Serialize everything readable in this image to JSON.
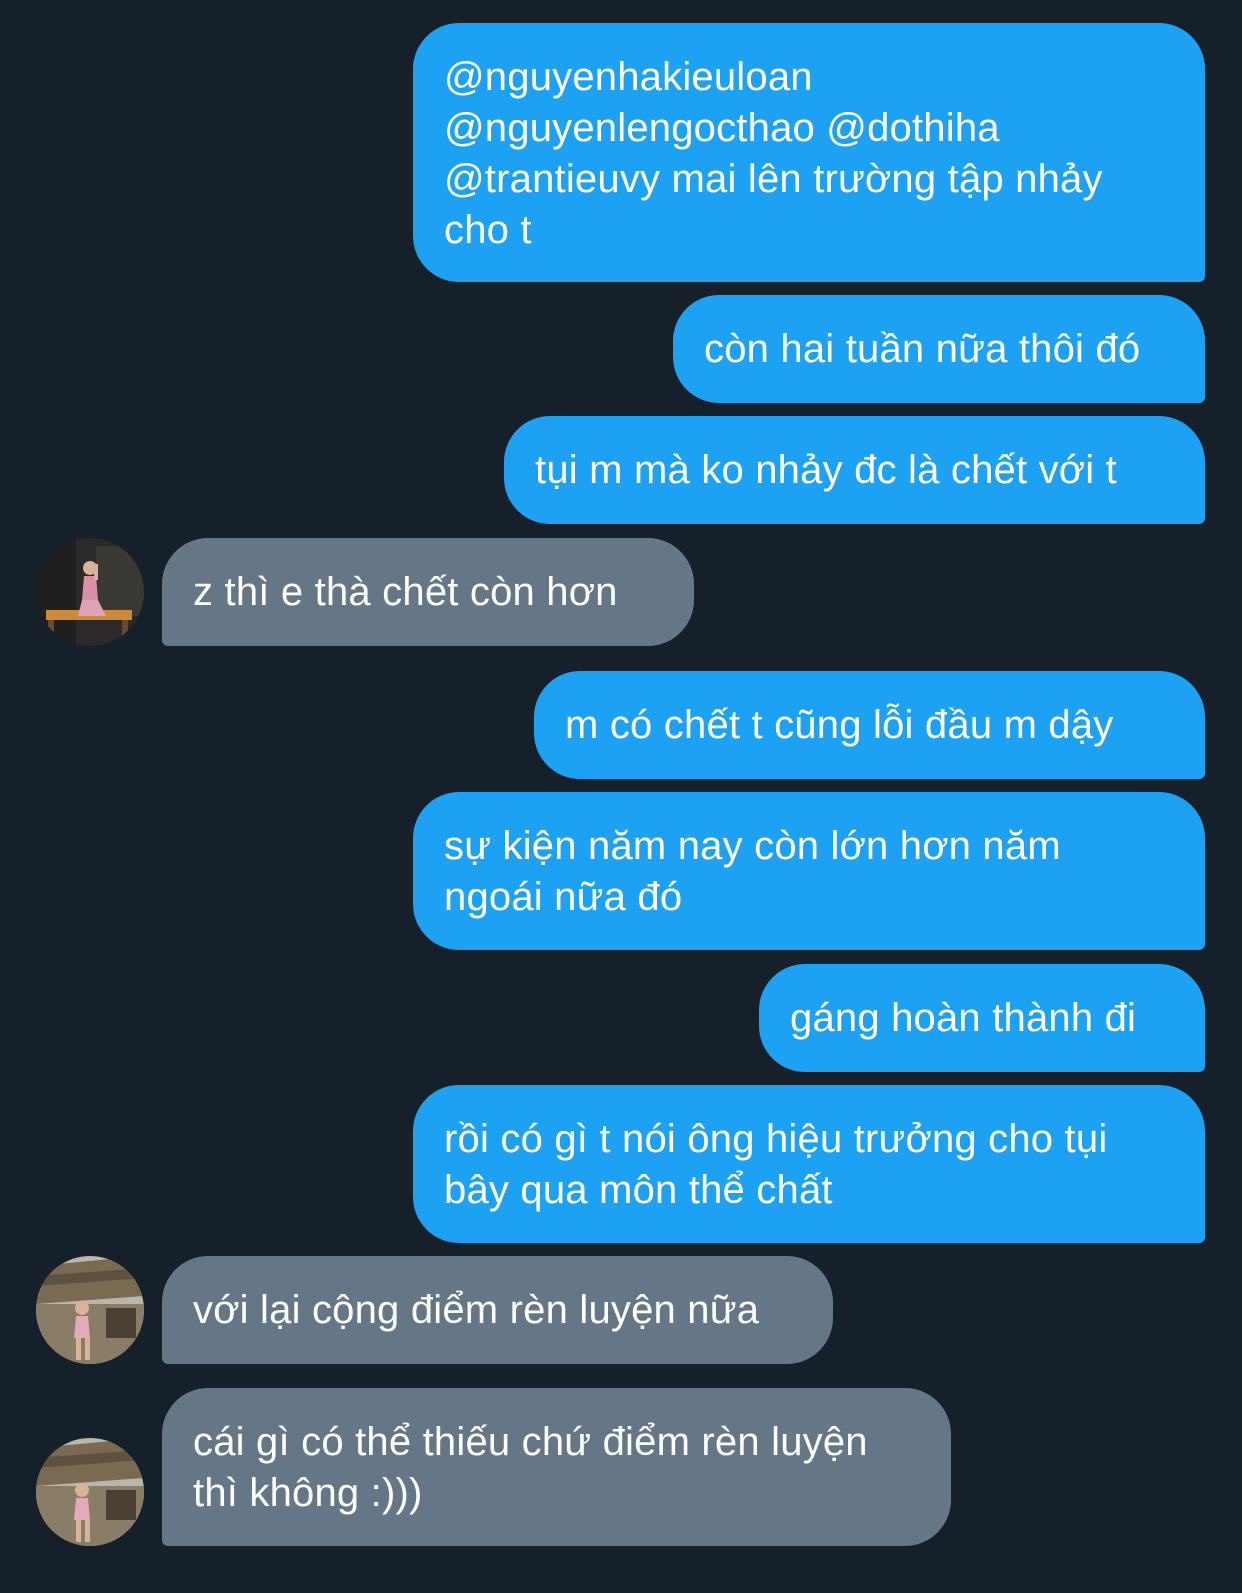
{
  "conversation": {
    "messages": [
      {
        "direction": "sent",
        "text": "@nguyenhakieuloan\n@nguyenlengocthao @dothiha\n@trantieuvy mai lên trường tập nhảy\ncho t"
      },
      {
        "direction": "sent",
        "text": "còn hai tuần nữa thôi đó"
      },
      {
        "direction": "sent",
        "text": "tụi m mà ko nhảy đc là chết với t"
      },
      {
        "direction": "received",
        "text": "z thì e thà chết còn hơn",
        "avatar": "contact-avatar"
      },
      {
        "direction": "sent",
        "text": "m có chết t cũng lỗi đầu m dậy"
      },
      {
        "direction": "sent",
        "text": "sự kiện năm nay còn lớn hơn năm\nngoái nữa đó"
      },
      {
        "direction": "sent",
        "text": "gáng hoàn thành đi"
      },
      {
        "direction": "sent",
        "text": "rồi có gì t nói ông hiệu trưởng cho tụi\nbây qua môn thể chất"
      },
      {
        "direction": "received",
        "text": "với lại cộng điểm rèn luyện nữa",
        "avatar": "contact-avatar"
      },
      {
        "direction": "received",
        "text": "cái gì có thể thiếu chứ điểm rèn luyện\nthì không :)))",
        "avatar": "contact-avatar"
      }
    ]
  },
  "colors": {
    "background": "#16202b",
    "sent_bubble": "#1da1f2",
    "received_bubble": "#657786",
    "text": "#ffffff"
  }
}
